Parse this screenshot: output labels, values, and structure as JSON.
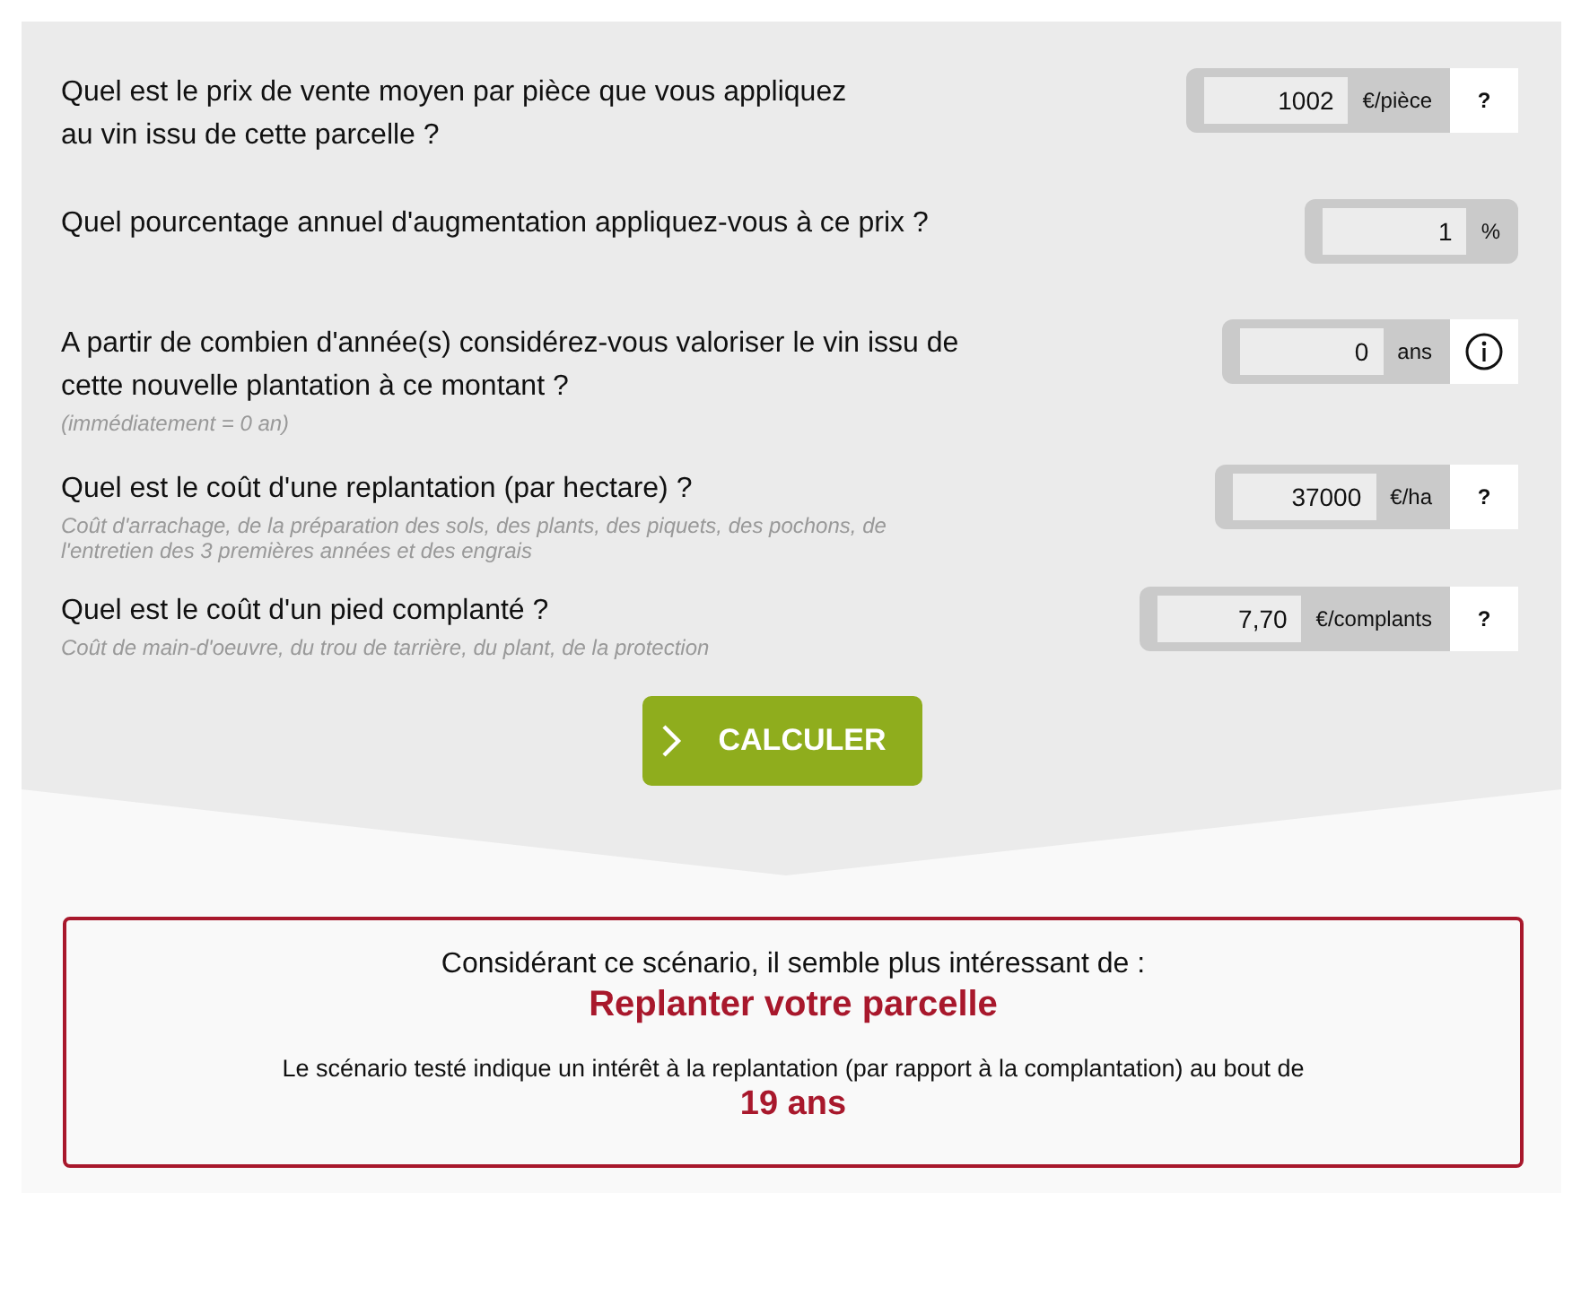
{
  "questions": [
    {
      "question": "Quel est le prix de vente moyen par pièce que vous appliquez\nau vin issu de cette parcelle ?",
      "value": "1002",
      "unit": "€/pièce",
      "help": {
        "kind": "text",
        "label": "?"
      }
    },
    {
      "question": "Quel pourcentage annuel d'augmentation appliquez-vous à ce prix ?",
      "value": "1",
      "unit": "%"
    },
    {
      "question": "A partir de combien d'année(s) considérez-vous valoriser le vin issu de\ncette nouvelle plantation à ce montant ?",
      "hint": "(immédiatement = 0 an)",
      "value": "0",
      "unit": "ans",
      "help": {
        "kind": "info"
      }
    },
    {
      "question": "Quel est le coût d'une replantation (par hectare) ?",
      "hint": "Coût d'arrachage, de la préparation des sols, des plants, des piquets, des pochons, de\nl'entretien des 3 premières années et des engrais",
      "value": "37000",
      "unit": "€/ha",
      "help": {
        "kind": "text",
        "label": "?"
      }
    },
    {
      "question": "Quel est le coût d'un pied complanté ?",
      "hint": "Coût de main-d'oeuvre, du trou de tarrière, du plant, de la protection",
      "value": "7,70",
      "unit": "€/complants",
      "help": {
        "kind": "text",
        "label": "?"
      }
    }
  ],
  "button": {
    "label": "CALCULER"
  },
  "result": {
    "intro": "Considérant ce scénario, il semble plus intéressant de :",
    "verdict": "Replanter votre parcelle",
    "detail": "Le scénario testé indique un intérêt à la replantation (par rapport à la complantation) au bout de",
    "duration": "19 ans"
  }
}
